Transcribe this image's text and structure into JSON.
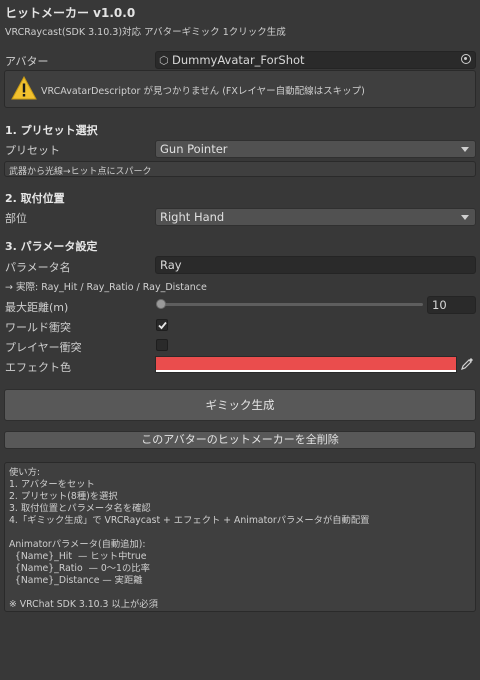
{
  "header": {
    "title": "ヒットメーカー v1.0.0",
    "subtitle": "VRCRaycast(SDK 3.10.3)対応 アバターギミック 1クリック生成"
  },
  "avatar": {
    "label": "アバター",
    "value": "DummyAvatar_ForShot"
  },
  "warning": {
    "text": "VRCAvatarDescriptor が見つかりません (FXレイヤー自動配線はスキップ)"
  },
  "preset": {
    "section_title": "1. プリセット選択",
    "label": "プリセット",
    "value": "Gun Pointer",
    "description": "武器から光線→ヒット点にスパーク"
  },
  "mount": {
    "section_title": "2. 取付位置",
    "label": "部位",
    "value": "Right Hand"
  },
  "params": {
    "section_title": "3. パラメータ設定",
    "name_label": "パラメータ名",
    "name_value": "Ray",
    "actual_note": "→ 実際: Ray_Hit / Ray_Ratio / Ray_Distance",
    "max_distance_label": "最大距離(m)",
    "max_distance_value": "10",
    "slider_min": 0,
    "slider_max": 100,
    "world_collision_label": "ワールド衝突",
    "world_collision_checked": true,
    "player_collision_label": "プレイヤー衝突",
    "player_collision_checked": false,
    "effect_color_label": "エフェクト色",
    "effect_color": "#ea4d4d"
  },
  "buttons": {
    "generate": "ギミック生成",
    "delete_all": "このアバターのヒットメーカーを全削除"
  },
  "help": {
    "lines": [
      "使い方:",
      "1. アバターをセット",
      "2. プリセット(8種)を選択",
      "3. 取付位置とパラメータ名を確認",
      "4.「ギミック生成」で VRCRaycast + エフェクト + Animatorパラメータが自動配置",
      "",
      "Animatorパラメータ(自動追加):",
      "  {Name}_Hit  — ヒット中true",
      "  {Name}_Ratio  — 0〜1の比率",
      "  {Name}_Distance — 実距離",
      "",
      "※ VRChat SDK 3.10.3 以上が必須"
    ]
  }
}
